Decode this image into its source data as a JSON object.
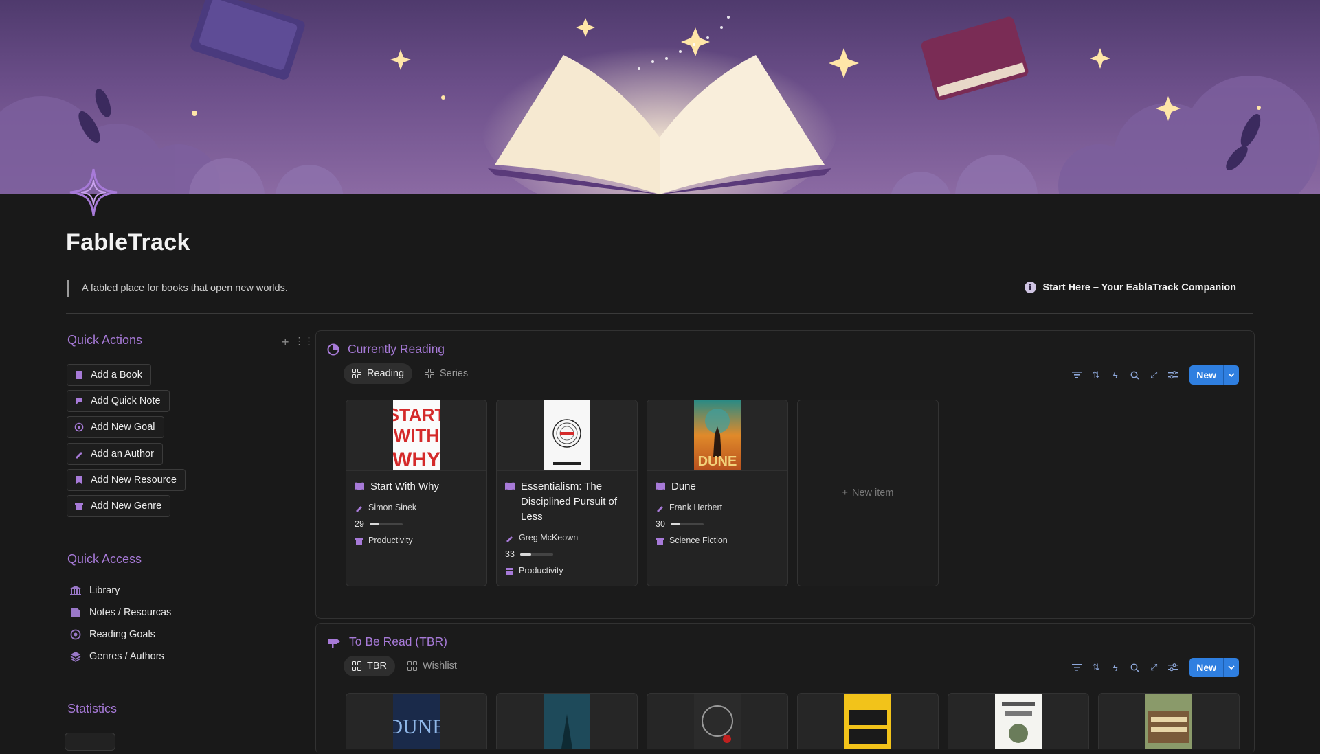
{
  "page": {
    "title": "FableTrack",
    "tagline": "A fabled place for books that open new worlds.",
    "start_link": "Start Here – Your EablaTrack Companion"
  },
  "quick_actions": {
    "heading": "Quick Actions",
    "items": [
      {
        "label": "Add a Book",
        "icon": "book-icon"
      },
      {
        "label": "Add Quick Note",
        "icon": "chat-icon"
      },
      {
        "label": "Add New Goal",
        "icon": "target-icon"
      },
      {
        "label": "Add an Author",
        "icon": "pen-icon"
      },
      {
        "label": "Add New Resource",
        "icon": "bookmark-icon"
      },
      {
        "label": "Add New Genre",
        "icon": "archive-icon"
      }
    ]
  },
  "quick_access": {
    "heading": "Quick Access",
    "items": [
      {
        "label": "Library",
        "icon": "library-icon"
      },
      {
        "label": "Notes / Resourcas",
        "icon": "document-icon"
      },
      {
        "label": "Reading Goals",
        "icon": "target-icon"
      },
      {
        "label": "Genres / Authors",
        "icon": "layers-icon"
      }
    ]
  },
  "statistics": {
    "heading": "Statistics"
  },
  "currently_reading": {
    "title": "Currently Reading",
    "tabs": [
      "Reading",
      "Series"
    ],
    "new_label": "New",
    "new_item_label": "New item",
    "books": [
      {
        "title": "Start With Why",
        "author": "Simon Sinek",
        "progress": 29,
        "genre": "Productivity",
        "cover": "start-with-why-cover"
      },
      {
        "title": "Essentialism: The Disciplined Pursuit of Less",
        "author": "Greg McKeown",
        "progress": 33,
        "genre": "Productivity",
        "cover": "essentialism-cover"
      },
      {
        "title": "Dune",
        "author": "Frank Herbert",
        "progress": 30,
        "genre": "Science Fiction",
        "cover": "dune-cover"
      }
    ]
  },
  "tbr": {
    "title": "To Be Read (TBR)",
    "tabs": [
      "TBR",
      "Wishlist"
    ],
    "new_label": "New",
    "covers": [
      "dune-cover",
      "the-name-of-the-wind-cover",
      "circe-cover",
      "deep-work-cover",
      "psychology-of-money-cover",
      "your-money-cover"
    ]
  },
  "colors": {
    "accent": "#a77ad8",
    "new_button": "#2f7fe0",
    "background": "#191919"
  }
}
